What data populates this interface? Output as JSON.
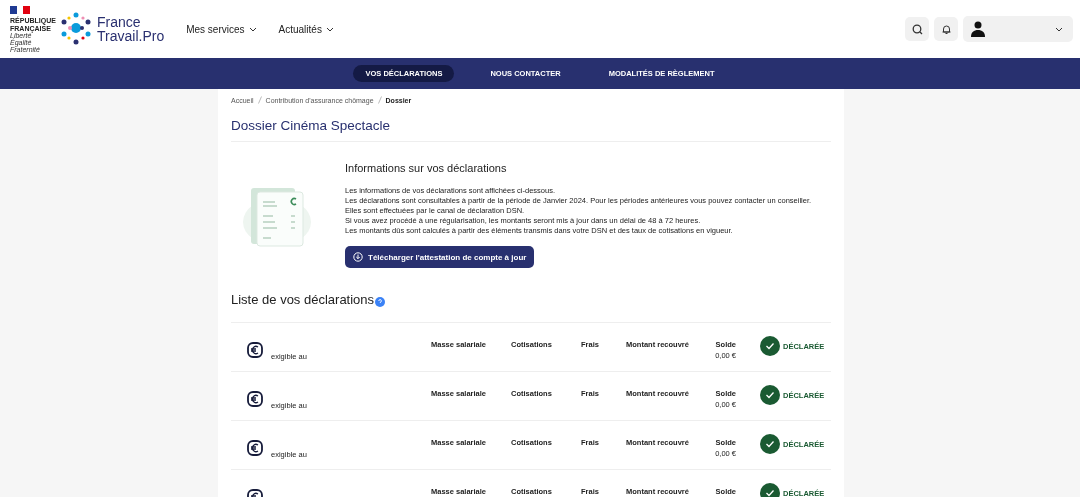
{
  "header": {
    "gov_lines": [
      "RÉPUBLIQUE",
      "FRANÇAISE"
    ],
    "gov_motto": [
      "Liberté",
      "Égalité",
      "Fraternité"
    ],
    "brand_lines": [
      "France",
      "Travail"
    ],
    "brand_suffix": ".Pro",
    "menu": [
      {
        "label": "Mes services"
      },
      {
        "label": "Actualités"
      }
    ]
  },
  "subnav": [
    {
      "label": "VOS DÉCLARATIONS",
      "selected": true
    },
    {
      "label": "NOUS CONTACTER",
      "selected": false
    },
    {
      "label": "MODALITÉS DE RÈGLEMENT",
      "selected": false
    }
  ],
  "breadcrumb": [
    "Accueil",
    "Contribution d'assurance chômage",
    "Dossier"
  ],
  "title": "Dossier Cinéma Spectacle",
  "info": {
    "heading": "Informations sur vos déclarations",
    "lines": [
      "Les informations de vos déclarations sont affichées ci-dessous.",
      "Les déclarations sont consultables à partir de la période de Janvier 2024. Pour les périodes antérieures vous pouvez contacter un conseiller.",
      "Elles sont effectuées par le canal de déclaration DSN.",
      "Si vous avez procédé à une régularisation, les montants seront mis à jour dans un délai de 48 à 72 heures.",
      "Les montants dûs sont calculés à partir des éléments transmis dans votre DSN et des taux de cotisations en vigueur."
    ],
    "button": "Télécharger l'attestation de compte à jour"
  },
  "list": {
    "heading": "Liste de vos déclarations",
    "rows": [
      {
        "due": "exigible au",
        "columns": [
          "Masse salariale",
          "Cotisations",
          "Frais",
          "Montant recouvré"
        ],
        "solde_label": "Solde",
        "solde": "0,00 €",
        "status": "DÉCLARÉE"
      },
      {
        "due": "exigible au",
        "columns": [
          "Masse salariale",
          "Cotisations",
          "Frais",
          "Montant recouvré"
        ],
        "solde_label": "Solde",
        "solde": "0,00 €",
        "status": "DÉCLARÉE"
      },
      {
        "due": "exigible au",
        "columns": [
          "Masse salariale",
          "Cotisations",
          "Frais",
          "Montant recouvré"
        ],
        "solde_label": "Solde",
        "solde": "0,00 €",
        "status": "DÉCLARÉE"
      },
      {
        "columns": [
          "Masse salariale",
          "Cotisations",
          "Frais",
          "Montant recouvré"
        ],
        "solde_label": "Solde",
        "status": "DÉCLARÉE"
      }
    ]
  }
}
